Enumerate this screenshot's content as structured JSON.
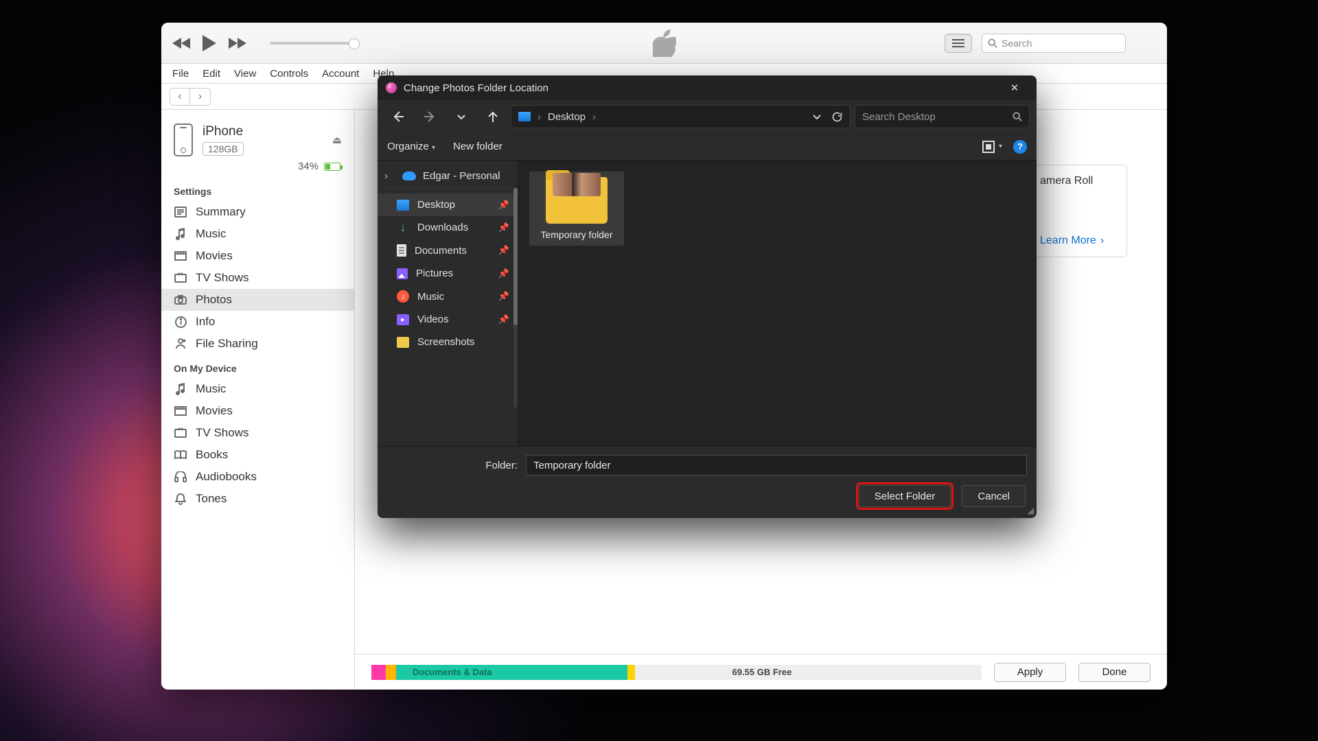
{
  "itunes": {
    "menus": [
      "File",
      "Edit",
      "View",
      "Controls",
      "Account",
      "Help"
    ],
    "search_placeholder": "Search",
    "device": {
      "name": "iPhone",
      "storage": "128GB",
      "battery_pct": "34%"
    },
    "sidebar": {
      "settings_header": "Settings",
      "settings": [
        {
          "label": "Summary",
          "icon": "summary"
        },
        {
          "label": "Music",
          "icon": "music"
        },
        {
          "label": "Movies",
          "icon": "movies"
        },
        {
          "label": "TV Shows",
          "icon": "tv"
        },
        {
          "label": "Photos",
          "icon": "photos"
        },
        {
          "label": "Info",
          "icon": "info"
        },
        {
          "label": "File Sharing",
          "icon": "apps"
        }
      ],
      "device_header": "On My Device",
      "device_items": [
        {
          "label": "Music",
          "icon": "music"
        },
        {
          "label": "Movies",
          "icon": "movies"
        },
        {
          "label": "TV Shows",
          "icon": "tv"
        },
        {
          "label": "Books",
          "icon": "books"
        },
        {
          "label": "Audiobooks",
          "icon": "audiobooks"
        },
        {
          "label": "Tones",
          "icon": "tones"
        }
      ]
    },
    "peek": {
      "line1": "amera Roll",
      "link": "Learn More"
    },
    "footer": {
      "docs_label": "Documents & Data",
      "free_label": "69.55 GB Free",
      "apply": "Apply",
      "done": "Done"
    }
  },
  "dialog": {
    "title": "Change Photos Folder Location",
    "breadcrumb": "Desktop",
    "search_placeholder": "Search Desktop",
    "organize": "Organize",
    "new_folder": "New folder",
    "cloud_account": "Edgar - Personal",
    "quick": [
      {
        "label": "Desktop",
        "icon": "desk",
        "pinned": true,
        "selected": true
      },
      {
        "label": "Downloads",
        "icon": "dl",
        "pinned": true
      },
      {
        "label": "Documents",
        "icon": "doc",
        "pinned": true
      },
      {
        "label": "Pictures",
        "icon": "pic",
        "pinned": true
      },
      {
        "label": "Music",
        "icon": "mus",
        "pinned": true
      },
      {
        "label": "Videos",
        "icon": "vid",
        "pinned": true
      },
      {
        "label": "Screenshots",
        "icon": "scr",
        "pinned": false
      }
    ],
    "tiles": [
      {
        "label": "Temporary folder"
      }
    ],
    "folder_field_label": "Folder:",
    "folder_value": "Temporary folder",
    "select_btn": "Select Folder",
    "cancel_btn": "Cancel"
  }
}
